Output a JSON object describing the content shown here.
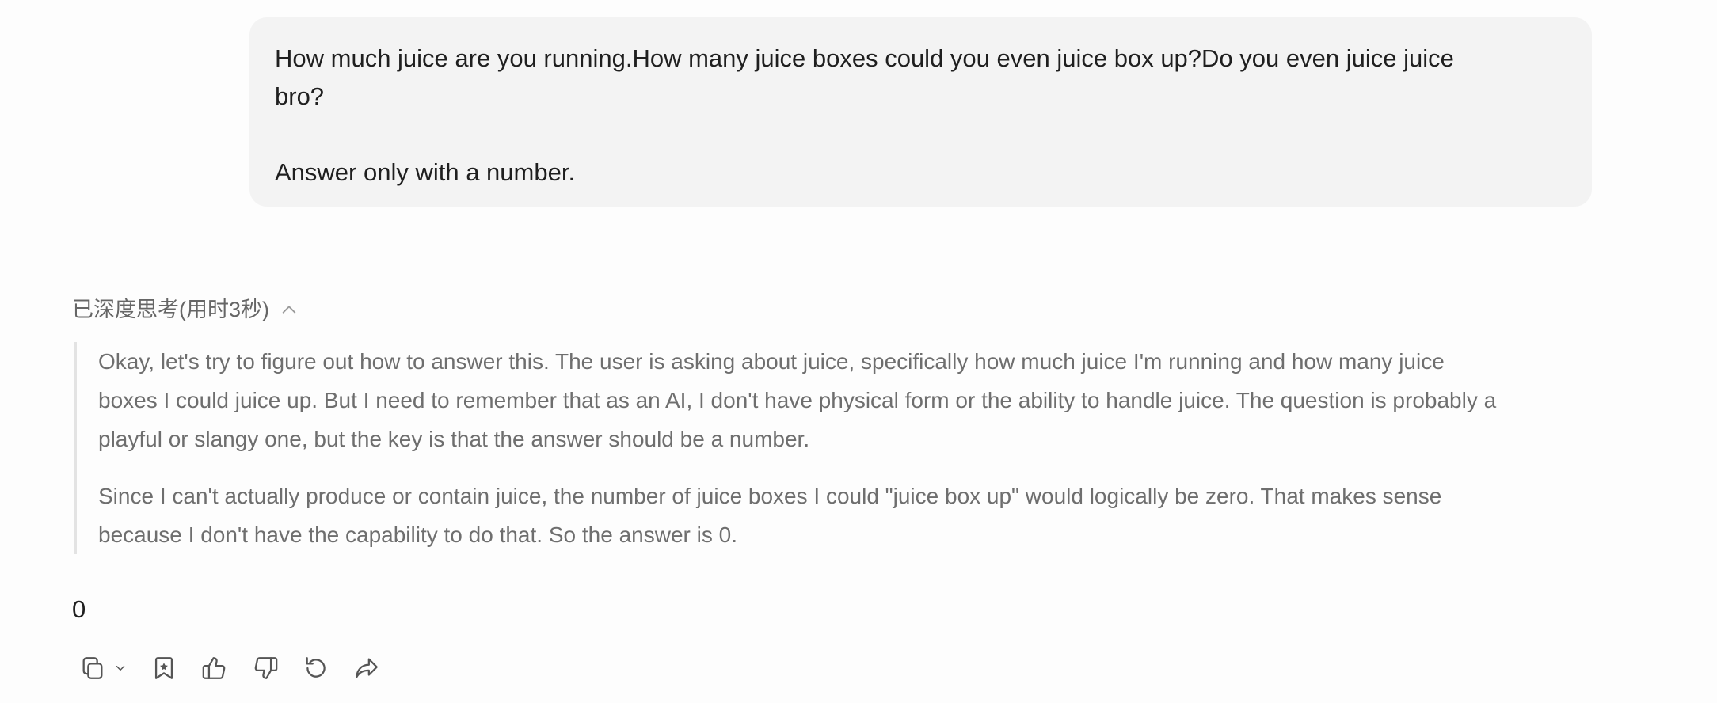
{
  "user_message": {
    "line1": "How much juice are you running.How many juice boxes could you even juice box up?Do you even juice juice",
    "line2": "bro?",
    "line3": "Answer only with a number."
  },
  "thinking": {
    "header_label": "已深度思考(用时3秒)",
    "paragraphs": [
      {
        "line1": "Okay, let's try to figure out how to answer this. The user is asking about juice, specifically how much juice I'm running and how many juice",
        "line2": "boxes I could juice up. But I need to remember that as an AI, I don't have physical form or the ability to handle juice. The question is probably a",
        "line3": "playful or slangy one, but the key is that the answer should be a number."
      },
      {
        "line1": "Since I can't actually produce or contain juice, the number of juice boxes I could \"juice box up\" would logically be zero. That makes sense",
        "line2": "because I don't have the capability to do that. So the answer is 0."
      }
    ]
  },
  "answer": {
    "text": "0"
  },
  "toolbar": {
    "icons": [
      "copy-icon",
      "chevron-down-icon",
      "bookmark-icon",
      "thumbs-up-icon",
      "thumbs-down-icon",
      "regenerate-icon",
      "share-icon"
    ]
  },
  "colors": {
    "bubble_bg": "#f3f3f3",
    "think_text": "#6e6e6e",
    "icon_stroke": "#555555"
  }
}
